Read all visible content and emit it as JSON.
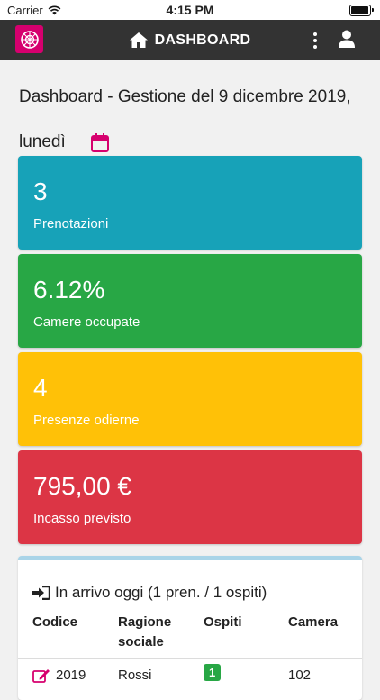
{
  "status_bar": {
    "carrier": "Carrier",
    "time": "4:15 PM"
  },
  "app_bar": {
    "title": "DASHBOARD"
  },
  "heading": {
    "line1": "Dashboard - Gestione del 9 dicembre 2019,",
    "line2": "lunedì"
  },
  "cards": [
    {
      "value": "3",
      "label": "Prenotazioni",
      "color": "#17a2b8"
    },
    {
      "value": "6.12%",
      "label": "Camere occupate",
      "color": "#28a745"
    },
    {
      "value": "4",
      "label": "Presenze odierne",
      "color": "#ffc107"
    },
    {
      "value": "795,00 €",
      "label": "Incasso previsto",
      "color": "#dc3545"
    }
  ],
  "arrivals": {
    "title": "In arrivo oggi (1 pren. / 1 ospiti)",
    "columns": [
      "Codice",
      "Ragione sociale",
      "Ospiti",
      "Camera"
    ],
    "rows": [
      {
        "codice": "2019",
        "ragione": "Rossi",
        "ospiti": "1",
        "camera": "102"
      }
    ]
  },
  "colors": {
    "app_bar": "#333333",
    "brand": "#d6006e",
    "panel_accent": "#a9d4e8"
  }
}
